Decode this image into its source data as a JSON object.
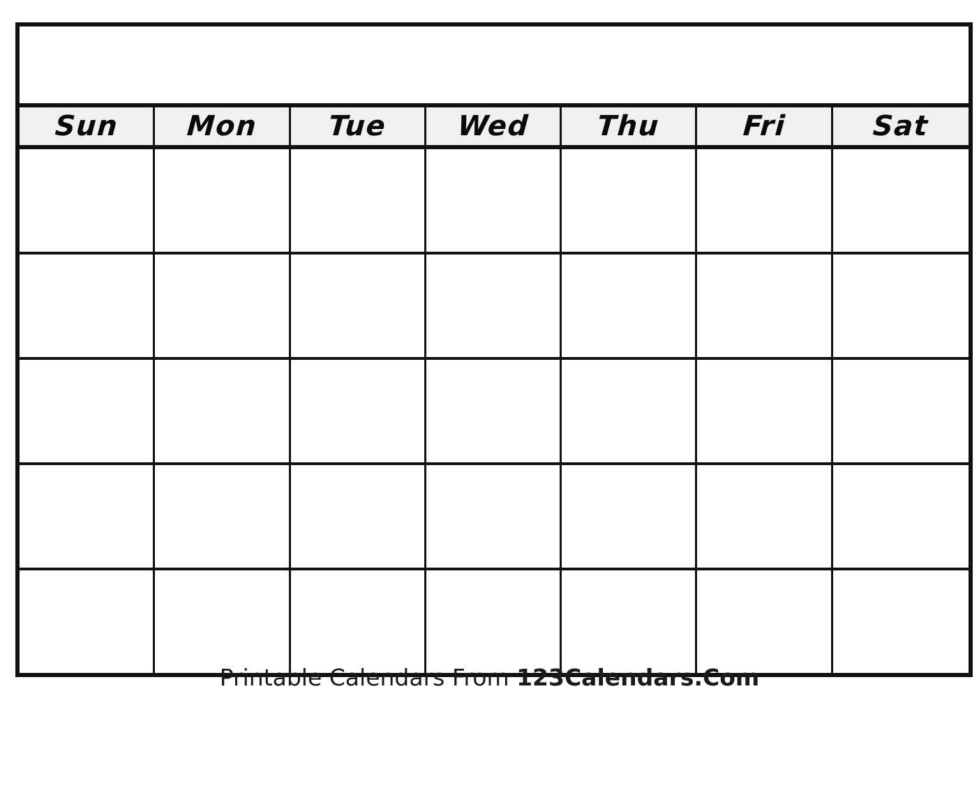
{
  "calendar": {
    "title": "",
    "title_placeholder": "",
    "weekdays": [
      {
        "label": "Sun"
      },
      {
        "label": "Mon"
      },
      {
        "label": "Tue"
      },
      {
        "label": "Wed"
      },
      {
        "label": "Thu"
      },
      {
        "label": "Fri"
      },
      {
        "label": "Sat"
      }
    ],
    "weeks": [
      {
        "days": [
          "",
          "",
          "",
          "",
          "",
          "",
          ""
        ]
      },
      {
        "days": [
          "",
          "",
          "",
          "",
          "",
          "",
          ""
        ]
      },
      {
        "days": [
          "",
          "",
          "",
          "",
          "",
          "",
          ""
        ]
      },
      {
        "days": [
          "",
          "",
          "",
          "",
          "",
          "",
          ""
        ]
      },
      {
        "days": [
          "",
          "",
          "",
          "",
          "",
          "",
          ""
        ]
      }
    ],
    "colors": {
      "border": "#111111",
      "header_background": "#f0f0f0",
      "cell_background": "#ffffff",
      "page_background": "#ffffff",
      "text": "#111111"
    }
  },
  "footer": {
    "prefix": "Printable Calendars From ",
    "brand": "123Calendars.Com"
  }
}
